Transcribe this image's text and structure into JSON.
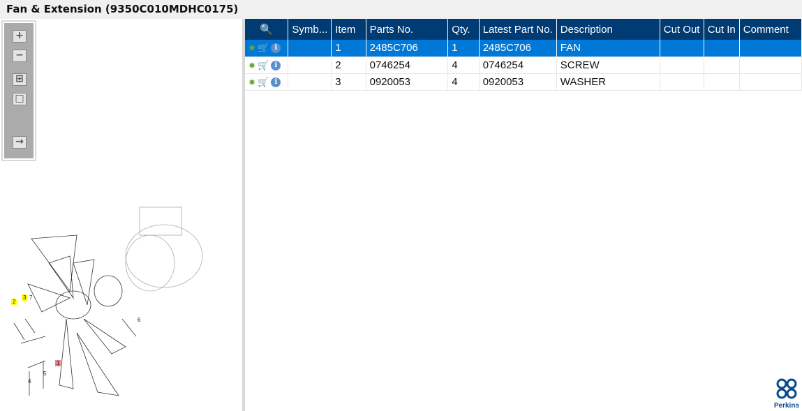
{
  "title": "Fan & Extension (9350C010MDHC0175)",
  "toolbar": [
    {
      "icon": "zoom-in-icon",
      "label": "+"
    },
    {
      "icon": "zoom-out-icon",
      "label": "−"
    },
    {
      "icon": "fit-all-icon",
      "label": "⊞"
    },
    {
      "icon": "fit-window-icon",
      "label": "□"
    },
    {
      "icon": "export-icon",
      "label": "→"
    }
  ],
  "diagram": {
    "callouts": [
      "1",
      "2",
      "3",
      "4",
      "5",
      "6",
      "7"
    ]
  },
  "table": {
    "headers": [
      "",
      "Symb...",
      "Item",
      "Parts No.",
      "Qty.",
      "Latest Part No.",
      "Description",
      "Cut Out",
      "Cut In",
      "Comment"
    ],
    "rows": [
      {
        "item": "1",
        "parts_no": "2485C706",
        "qty": "1",
        "latest": "2485C706",
        "description": "FAN",
        "selected": true
      },
      {
        "item": "2",
        "parts_no": "0746254",
        "qty": "4",
        "latest": "0746254",
        "description": "SCREW",
        "selected": false
      },
      {
        "item": "3",
        "parts_no": "0920053",
        "qty": "4",
        "latest": "0920053",
        "description": "WASHER",
        "selected": false
      }
    ]
  },
  "logo": {
    "text": "Perkins"
  },
  "colors": {
    "header": "#003b73",
    "selected": "#0078d7"
  }
}
